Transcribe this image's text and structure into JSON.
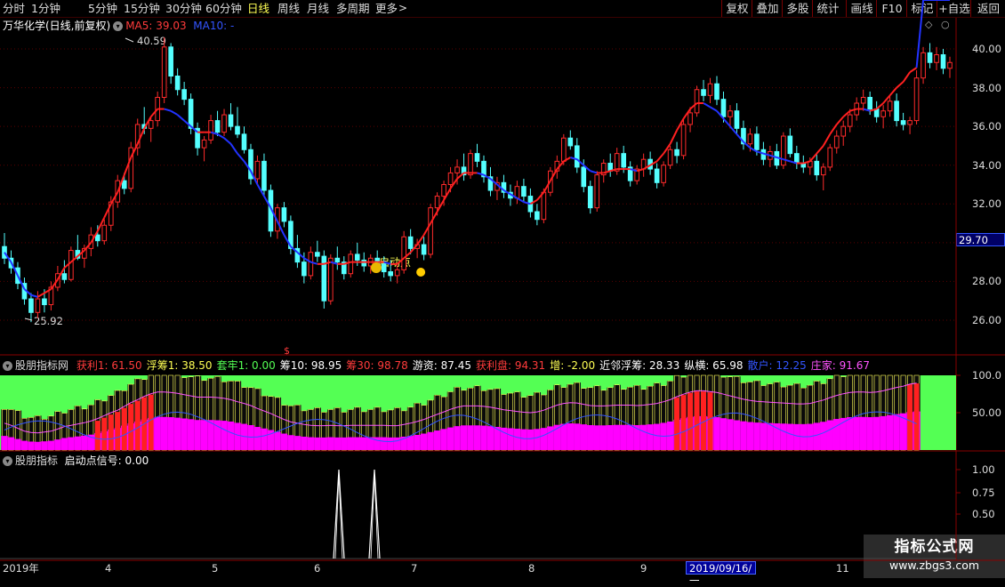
{
  "toolbar": {
    "periods": [
      {
        "label": "分时",
        "x": 3
      },
      {
        "label": "1分钟",
        "x": 35
      },
      {
        "label": "5分钟",
        "x": 99
      },
      {
        "label": "15分钟",
        "x": 139
      },
      {
        "label": "30分钟",
        "x": 186
      },
      {
        "label": "60分钟",
        "x": 231
      },
      {
        "label": "日线",
        "x": 278,
        "active": true
      },
      {
        "label": "周线",
        "x": 312
      },
      {
        "label": "月线",
        "x": 345
      },
      {
        "label": "多周期",
        "x": 378
      },
      {
        "label": "更多",
        "x": 422
      }
    ],
    "more_chevron": ">",
    "right_buttons": [
      {
        "label": "复权",
        "x": 811,
        "w": 34
      },
      {
        "label": "叠加",
        "x": 845,
        "w": 34
      },
      {
        "label": "多股",
        "x": 879,
        "w": 34
      },
      {
        "label": "统计",
        "x": 913,
        "w": 34
      },
      {
        "label": "画线",
        "x": 951,
        "w": 34
      },
      {
        "label": "F10",
        "x": 985,
        "w": 34
      },
      {
        "label": "标记",
        "x": 1019,
        "w": 34
      },
      {
        "label": "+自选",
        "x": 1053,
        "w": 38
      },
      {
        "label": "返回",
        "x": 1091,
        "w": 39
      }
    ]
  },
  "main_panel": {
    "title": "万华化学(日线,前复权)",
    "ma5_label": "MA5: 39.03",
    "ma10_label": "MA10: -",
    "price_axis": [
      "40.00",
      "38.00",
      "36.00",
      "34.00",
      "32.00",
      "30.00",
      "28.00",
      "26.00"
    ],
    "current_price": "29.70",
    "high_label": "40.59",
    "low_label": "25.92",
    "signal_label": "启动点",
    "ref_marker": "$"
  },
  "indicator_panel": {
    "name": "股朋指标网",
    "fields": [
      {
        "label": "获利1: 61.50",
        "color": "#ff3b3b"
      },
      {
        "label": "浮筹1: 38.50",
        "color": "#ffff54"
      },
      {
        "label": "套牢1: 0.00",
        "color": "#54ff54"
      },
      {
        "label": "筹10: 98.95",
        "color": "#ffffff"
      },
      {
        "label": "筹30: 98.78",
        "color": "#ff3b3b"
      },
      {
        "label": "游资: 87.45",
        "color": "#ffffff"
      },
      {
        "label": "获利盘: 94.31",
        "color": "#ff3b3b"
      },
      {
        "label": "增: -2.00",
        "color": "#ffff54"
      },
      {
        "label": "近邻浮筹: 28.33",
        "color": "#ffffff"
      },
      {
        "label": "纵横: 65.98",
        "color": "#ffffff"
      },
      {
        "label": "散户: 12.25",
        "color": "#3355ff"
      },
      {
        "label": "庄家: 91.67",
        "color": "#ff54ff"
      }
    ],
    "axis": [
      "100.0",
      "50.00"
    ]
  },
  "signal_panel": {
    "name": "股朋指标",
    "signal_label": "启动点信号: 0.00",
    "axis": [
      "1.00",
      "0.75",
      "0.50"
    ]
  },
  "date_axis": [
    {
      "label": "2019年",
      "x": 3
    },
    {
      "label": "4",
      "x": 118
    },
    {
      "label": "5",
      "x": 238
    },
    {
      "label": "6",
      "x": 353
    },
    {
      "label": "7",
      "x": 462
    },
    {
      "label": "8",
      "x": 594
    },
    {
      "label": "9",
      "x": 720
    },
    {
      "label": "11",
      "x": 940
    }
  ],
  "selected_date": "2019/09/16/一",
  "watermark": {
    "line1": "指标公式网",
    "line2": "www.zbgs3.com"
  },
  "colors": {
    "up": "#ff2b2b",
    "down": "#54ffff",
    "ma5": "#ff2020",
    "ma10": "#2233ff",
    "profit": "#ff00ff",
    "float": "#ffff54",
    "trap": "#54ff54"
  },
  "chart_data": {
    "type": "candlestick",
    "ylim": [
      25,
      41
    ],
    "ohlc": [
      [
        29.8,
        30.5,
        28.9,
        29.2
      ],
      [
        29.2,
        29.6,
        28.4,
        28.7
      ],
      [
        28.7,
        29.0,
        27.6,
        27.9
      ],
      [
        27.9,
        28.2,
        26.8,
        27.1
      ],
      [
        27.1,
        27.4,
        25.9,
        26.4
      ],
      [
        26.4,
        27.5,
        26.1,
        27.1
      ],
      [
        27.1,
        27.6,
        26.4,
        26.8
      ],
      [
        26.8,
        28.0,
        26.5,
        27.7
      ],
      [
        27.7,
        28.8,
        27.5,
        28.4
      ],
      [
        28.4,
        29.1,
        27.9,
        28.1
      ],
      [
        28.1,
        29.8,
        28.0,
        29.6
      ],
      [
        29.6,
        30.4,
        29.1,
        29.2
      ],
      [
        29.2,
        29.9,
        28.7,
        29.7
      ],
      [
        29.7,
        30.8,
        29.3,
        30.4
      ],
      [
        30.4,
        30.9,
        29.8,
        30.1
      ],
      [
        30.1,
        31.2,
        29.9,
        30.9
      ],
      [
        30.9,
        32.4,
        30.6,
        32.1
      ],
      [
        32.1,
        33.5,
        31.8,
        33.2
      ],
      [
        33.2,
        33.6,
        32.5,
        32.8
      ],
      [
        32.8,
        35.2,
        32.6,
        34.9
      ],
      [
        34.9,
        36.4,
        34.5,
        36.1
      ],
      [
        36.1,
        37.0,
        35.6,
        35.9
      ],
      [
        35.9,
        36.5,
        35.2,
        36.3
      ],
      [
        36.3,
        37.8,
        36.0,
        37.5
      ],
      [
        37.5,
        40.6,
        37.2,
        40.1
      ],
      [
        40.1,
        40.3,
        38.2,
        38.6
      ],
      [
        38.6,
        39.0,
        37.6,
        37.9
      ],
      [
        37.9,
        38.3,
        37.1,
        37.4
      ],
      [
        37.4,
        37.7,
        35.6,
        35.9
      ],
      [
        35.9,
        36.2,
        34.5,
        34.9
      ],
      [
        34.9,
        35.5,
        34.2,
        35.3
      ],
      [
        35.3,
        36.6,
        35.1,
        36.3
      ],
      [
        36.3,
        36.8,
        35.5,
        35.7
      ],
      [
        35.7,
        36.9,
        35.5,
        36.6
      ],
      [
        36.6,
        37.2,
        35.8,
        36.0
      ],
      [
        36.0,
        37.0,
        35.4,
        35.6
      ],
      [
        35.6,
        36.0,
        34.6,
        34.8
      ],
      [
        34.8,
        35.1,
        33.0,
        33.3
      ],
      [
        33.3,
        34.5,
        33.0,
        34.2
      ],
      [
        34.2,
        34.6,
        32.4,
        32.7
      ],
      [
        32.7,
        33.0,
        30.3,
        30.6
      ],
      [
        30.6,
        32.0,
        30.2,
        31.8
      ],
      [
        31.8,
        32.1,
        30.8,
        31.1
      ],
      [
        31.1,
        31.4,
        29.4,
        29.7
      ],
      [
        29.7,
        30.4,
        28.7,
        29.0
      ],
      [
        29.0,
        29.5,
        27.9,
        28.3
      ],
      [
        28.3,
        29.8,
        28.1,
        29.5
      ],
      [
        29.5,
        30.1,
        29.0,
        29.3
      ],
      [
        29.3,
        29.6,
        26.6,
        27.0
      ],
      [
        27.0,
        29.4,
        26.8,
        29.2
      ],
      [
        29.2,
        29.8,
        28.6,
        29.0
      ],
      [
        29.0,
        29.3,
        28.1,
        28.4
      ],
      [
        28.4,
        29.6,
        28.2,
        29.4
      ],
      [
        29.4,
        30.0,
        28.8,
        29.1
      ],
      [
        29.1,
        29.5,
        28.5,
        28.8
      ],
      [
        28.8,
        29.4,
        28.4,
        29.2
      ],
      [
        29.2,
        29.6,
        28.6,
        28.9
      ],
      [
        28.9,
        29.3,
        28.2,
        28.5
      ],
      [
        28.5,
        29.1,
        28.0,
        28.3
      ],
      [
        28.3,
        28.9,
        27.9,
        28.6
      ],
      [
        28.6,
        30.6,
        28.4,
        30.3
      ],
      [
        30.3,
        30.7,
        29.4,
        29.7
      ],
      [
        29.7,
        30.2,
        29.2,
        29.9
      ],
      [
        29.9,
        30.3,
        29.1,
        29.4
      ],
      [
        29.4,
        32.0,
        29.2,
        31.8
      ],
      [
        31.8,
        32.6,
        31.4,
        32.4
      ],
      [
        32.4,
        33.2,
        31.9,
        33.0
      ],
      [
        33.0,
        33.9,
        32.6,
        33.6
      ],
      [
        33.6,
        34.3,
        33.0,
        33.9
      ],
      [
        33.9,
        34.6,
        33.2,
        33.5
      ],
      [
        33.5,
        34.8,
        33.3,
        34.6
      ],
      [
        34.6,
        35.1,
        33.9,
        34.2
      ],
      [
        34.2,
        34.5,
        33.1,
        33.4
      ],
      [
        33.4,
        33.9,
        32.4,
        32.7
      ],
      [
        32.7,
        33.4,
        32.2,
        33.1
      ],
      [
        33.1,
        33.5,
        32.3,
        32.6
      ],
      [
        32.6,
        33.0,
        31.9,
        32.3
      ],
      [
        32.3,
        33.2,
        32.0,
        32.9
      ],
      [
        32.9,
        33.3,
        32.1,
        32.4
      ],
      [
        32.4,
        32.8,
        31.3,
        31.6
      ],
      [
        31.6,
        32.0,
        30.9,
        31.2
      ],
      [
        31.2,
        32.8,
        31.0,
        32.6
      ],
      [
        32.6,
        33.9,
        32.4,
        33.7
      ],
      [
        33.7,
        34.5,
        33.3,
        34.2
      ],
      [
        34.2,
        35.6,
        34.0,
        35.4
      ],
      [
        35.4,
        35.8,
        34.8,
        35.0
      ],
      [
        35.0,
        35.4,
        33.6,
        33.9
      ],
      [
        33.9,
        34.3,
        32.6,
        32.9
      ],
      [
        32.9,
        33.2,
        31.5,
        31.8
      ],
      [
        31.8,
        33.7,
        31.6,
        33.5
      ],
      [
        33.5,
        34.3,
        33.1,
        34.1
      ],
      [
        34.1,
        34.6,
        33.4,
        33.7
      ],
      [
        33.7,
        34.9,
        33.5,
        34.6
      ],
      [
        34.6,
        35.0,
        33.6,
        33.9
      ],
      [
        33.9,
        34.2,
        32.9,
        33.2
      ],
      [
        33.2,
        34.0,
        33.0,
        33.8
      ],
      [
        33.8,
        34.6,
        33.4,
        34.3
      ],
      [
        34.3,
        34.7,
        33.5,
        33.8
      ],
      [
        33.8,
        34.1,
        32.8,
        33.1
      ],
      [
        33.1,
        34.2,
        32.9,
        34.0
      ],
      [
        34.0,
        35.0,
        33.8,
        34.8
      ],
      [
        34.8,
        35.2,
        34.1,
        34.5
      ],
      [
        34.5,
        36.4,
        34.3,
        36.1
      ],
      [
        36.1,
        37.0,
        35.7,
        36.7
      ],
      [
        36.7,
        38.1,
        36.5,
        37.9
      ],
      [
        37.9,
        38.4,
        37.3,
        37.6
      ],
      [
        37.6,
        38.5,
        37.2,
        38.2
      ],
      [
        38.2,
        38.6,
        37.1,
        37.4
      ],
      [
        37.4,
        37.8,
        36.2,
        36.5
      ],
      [
        36.5,
        37.1,
        35.9,
        36.8
      ],
      [
        36.8,
        37.2,
        35.6,
        35.9
      ],
      [
        35.9,
        36.3,
        34.8,
        35.1
      ],
      [
        35.1,
        35.9,
        34.7,
        35.6
      ],
      [
        35.6,
        36.0,
        34.5,
        34.8
      ],
      [
        34.8,
        35.2,
        34.0,
        34.3
      ],
      [
        34.3,
        35.0,
        33.9,
        34.7
      ],
      [
        34.7,
        35.1,
        33.8,
        34.0
      ],
      [
        34.0,
        35.7,
        33.8,
        35.5
      ],
      [
        35.5,
        35.9,
        34.4,
        34.6
      ],
      [
        34.6,
        35.0,
        33.8,
        34.1
      ],
      [
        34.1,
        34.5,
        33.6,
        33.9
      ],
      [
        33.9,
        34.4,
        33.5,
        34.2
      ],
      [
        34.2,
        34.6,
        33.2,
        33.5
      ],
      [
        33.5,
        34.1,
        32.7,
        33.9
      ],
      [
        33.9,
        35.1,
        33.7,
        34.9
      ],
      [
        34.9,
        35.8,
        34.6,
        35.5
      ],
      [
        35.5,
        36.3,
        35.0,
        36.0
      ],
      [
        36.0,
        36.9,
        35.7,
        36.6
      ],
      [
        36.6,
        37.5,
        36.3,
        37.2
      ],
      [
        37.2,
        37.9,
        36.8,
        37.5
      ],
      [
        37.5,
        37.8,
        36.6,
        36.9
      ],
      [
        36.9,
        37.3,
        36.2,
        36.5
      ],
      [
        36.5,
        37.1,
        35.9,
        36.8
      ],
      [
        36.8,
        37.6,
        36.5,
        37.3
      ],
      [
        37.3,
        37.7,
        36.0,
        36.3
      ],
      [
        36.3,
        36.7,
        35.8,
        36.1
      ],
      [
        36.1,
        36.5,
        35.6,
        36.3
      ],
      [
        36.3,
        38.9,
        36.1,
        38.5
      ],
      [
        38.5,
        40.1,
        38.2,
        39.8
      ],
      [
        39.8,
        40.3,
        39.0,
        39.3
      ],
      [
        39.3,
        40.1,
        38.9,
        39.7
      ],
      [
        39.7,
        40.0,
        38.7,
        39.0
      ],
      [
        39.0,
        39.6,
        38.5,
        39.3
      ]
    ],
    "ma5": [
      29.5,
      29.0,
      28.3,
      27.6,
      27.3,
      27.2,
      27.4,
      27.6,
      28.1,
      28.7,
      29.0,
      29.3,
      29.6,
      30.0,
      30.6,
      31.3,
      32.0,
      32.6,
      33.5,
      34.4,
      35.1,
      35.9,
      36.5,
      36.9,
      36.9,
      36.8,
      36.6,
      36.3,
      36.0,
      35.7,
      35.7,
      35.7,
      35.6,
      35.4,
      35.1,
      34.6,
      34.2,
      33.7,
      33.0,
      32.4,
      31.8,
      31.1,
      30.4,
      29.8,
      29.5,
      29.2,
      29.0,
      28.9,
      28.9,
      29.0,
      28.9,
      28.9,
      29.0,
      29.0,
      29.0,
      29.0,
      29.0,
      29.0,
      28.9,
      28.9,
      29.2,
      29.5,
      29.9,
      30.4,
      31.0,
      31.6,
      32.2,
      32.8,
      33.3,
      33.6,
      33.6,
      33.6,
      33.5,
      33.3,
      33.0,
      32.7,
      32.5,
      32.3,
      32.1,
      32.0,
      32.2,
      32.6,
      33.2,
      33.8,
      34.2,
      34.4,
      34.3,
      34.0,
      33.7,
      33.6,
      33.6,
      33.7,
      33.8,
      33.8,
      33.8,
      33.7,
      33.8,
      34.0,
      34.2,
      34.6,
      35.1,
      35.8,
      36.4,
      36.9,
      37.2,
      37.2,
      37.0,
      36.8,
      36.4,
      36.0,
      35.6,
      35.2,
      34.9,
      34.7,
      34.6,
      34.5,
      34.4,
      34.3,
      34.2,
      34.1,
      34.1,
      34.2,
      34.6,
      35.0,
      35.6,
      36.1,
      36.5,
      36.8,
      36.9,
      36.9,
      36.8,
      36.9,
      37.2,
      37.6,
      38.0,
      38.3,
      38.8,
      39.03
    ],
    "volume_profile_note": "chip distribution bands",
    "signal_bars": [
      62,
      71
    ]
  }
}
